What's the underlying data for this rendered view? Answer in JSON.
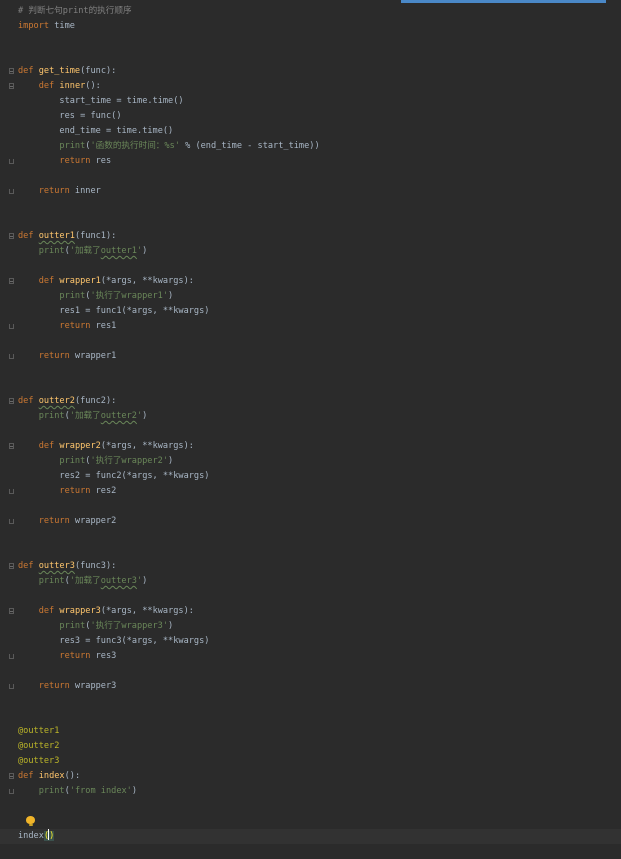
{
  "editor": {
    "lines": {
      "l1": "# 判断七句print的执行顺序",
      "l2_kw": "import",
      "l2_rest": " time",
      "def": "def",
      "return": "return",
      "get_time": "get_time",
      "get_time_args": "(func):",
      "inner": "inner",
      "inner_args": "():",
      "start_time": "start_time = time.time()",
      "res_func": "res = func()",
      "end_time": "end_time = time.time()",
      "print": "print",
      "time_str": "'函数的执行时间：%s'",
      "time_rest": " % (end_time - start_time))",
      "ret_res": " res",
      "ret_inner": " inner",
      "outter1": "outter1",
      "outter1_args": "(func1):",
      "load1_a": "'加载了",
      "load1_b": "outter1",
      "load1_c": "'",
      "wrapper1": "wrapper1",
      "wrapper_args": "(*args, **kwargs):",
      "exec1": "'执行了wrapper1'",
      "res1": "res1 = func1(*args, **kwargs)",
      "ret_res1": " res1",
      "ret_wrapper1": " wrapper1",
      "outter2": "outter2",
      "outter2_args": "(func2):",
      "load2_a": "'加载了",
      "load2_b": "outter2",
      "load2_c": "'",
      "wrapper2": "wrapper2",
      "exec2": "'执行了wrapper2'",
      "res2": "res2 = func2(*args, **kwargs)",
      "ret_res2": " res2",
      "ret_wrapper2": " wrapper2",
      "outter3": "outter3",
      "outter3_args": "(func3):",
      "load3_a": "'加载了",
      "load3_b": "outter3",
      "load3_c": "'",
      "wrapper3": "wrapper3",
      "exec3": "'执行了wrapper3'",
      "res3": "res3 = func3(*args, **kwargs)",
      "ret_res3": " res3",
      "ret_wrapper3": " wrapper3",
      "deco1": "@outter1",
      "deco2": "@outter2",
      "deco3": "@outter3",
      "index": "index",
      "index_args": "():",
      "from_index": "'from index'",
      "call_index": "index",
      "call_parens": "()"
    }
  }
}
